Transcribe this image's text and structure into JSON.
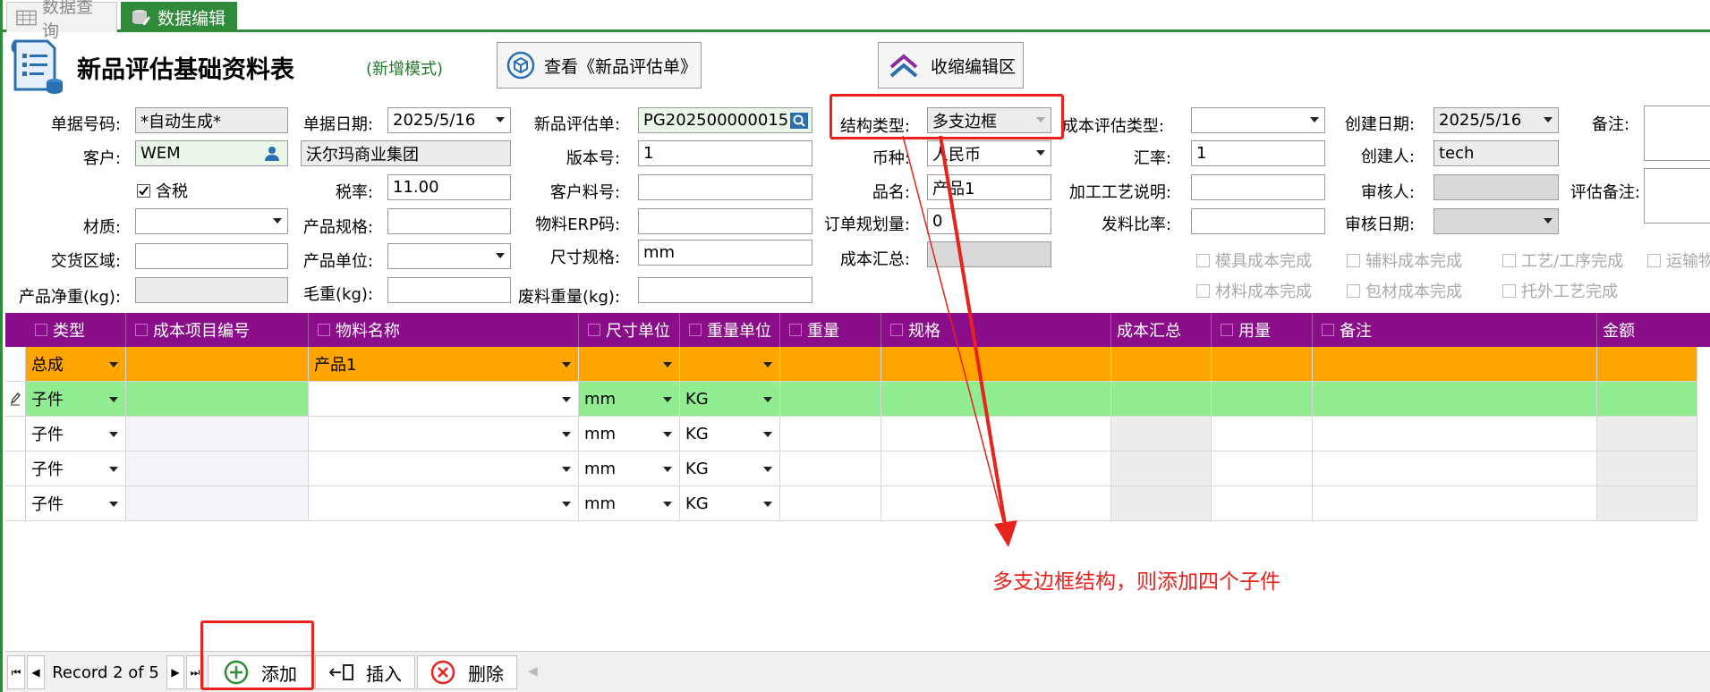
{
  "tabs": [
    {
      "label": "数据查询",
      "icon": "grid-table-icon",
      "active": false
    },
    {
      "label": "数据编辑",
      "icon": "database-edit-icon",
      "active": true
    }
  ],
  "header": {
    "title": "新品评估基础资料表",
    "mode": "(新增模式)",
    "view_button": "查看《新品评估单》",
    "collapse_button": "收缩编辑区"
  },
  "form": {
    "doc_no": {
      "label": "单据号码:",
      "value": "*自动生成*"
    },
    "doc_date": {
      "label": "单据日期:",
      "value": "2025/5/16"
    },
    "eval_no": {
      "label": "新品评估单:",
      "value": "PG202500000015"
    },
    "struct_type": {
      "label": "结构类型:",
      "value": "多支边框"
    },
    "cost_eval_type": {
      "label": "成本评估类型:",
      "value": ""
    },
    "create_date": {
      "label": "创建日期:",
      "value": "2025/5/16"
    },
    "remark": {
      "label": "备注:",
      "value": ""
    },
    "customer": {
      "label": "客户:",
      "value": "WEM",
      "name": "沃尔玛商业集团"
    },
    "version": {
      "label": "版本号:",
      "value": "1"
    },
    "currency": {
      "label": "币种:",
      "value": "人民币"
    },
    "rate": {
      "label": "汇率:",
      "value": "1"
    },
    "creator": {
      "label": "创建人:",
      "value": "tech"
    },
    "tax": {
      "label": "含税",
      "checked": true
    },
    "tax_rate": {
      "label": "税率:",
      "value": "11.00"
    },
    "cust_part": {
      "label": "客户料号:",
      "value": ""
    },
    "product_name": {
      "label": "品名:",
      "value": "产品1"
    },
    "process_desc": {
      "label": "加工工艺说明:",
      "value": ""
    },
    "auditor": {
      "label": "审核人:",
      "value": ""
    },
    "eval_remark": {
      "label": "评估备注:",
      "value": ""
    },
    "material": {
      "label": "材质:",
      "value": ""
    },
    "spec": {
      "label": "产品规格:",
      "value": ""
    },
    "erp_code": {
      "label": "物料ERP码:",
      "value": ""
    },
    "order_plan": {
      "label": "订单规划量:",
      "value": "0"
    },
    "issue_ratio": {
      "label": "发料比率:",
      "value": ""
    },
    "audit_date": {
      "label": "审核日期:",
      "value": ""
    },
    "delivery": {
      "label": "交货区域:",
      "value": ""
    },
    "unit": {
      "label": "产品单位:",
      "value": ""
    },
    "size_spec": {
      "label": "尺寸规格:",
      "value": "mm"
    },
    "cost_total": {
      "label": "成本汇总:",
      "value": ""
    },
    "net_weight": {
      "label": "产品净重(kg):",
      "value": ""
    },
    "gross_weight": {
      "label": "毛重(kg):",
      "value": ""
    },
    "scrap_weight": {
      "label": "废料重量(kg):",
      "value": ""
    }
  },
  "checks": [
    "模具成本完成",
    "辅料成本完成",
    "工艺/工序完成",
    "运输物",
    "材料成本完成",
    "包材成本完成",
    "托外工艺完成"
  ],
  "grid": {
    "columns": [
      "类型",
      "成本项目编号",
      "物料名称",
      "尺寸单位",
      "重量单位",
      "重量",
      "规格",
      "成本汇总",
      "用量",
      "备注",
      "金额"
    ],
    "rows": [
      {
        "type": "总成",
        "item": "",
        "material": "产品1",
        "size_unit": "",
        "weight_unit": "",
        "style": "orange"
      },
      {
        "type": "子件",
        "item": "",
        "material": "",
        "size_unit": "mm",
        "weight_unit": "KG",
        "style": "green"
      },
      {
        "type": "子件",
        "item": "",
        "material": "",
        "size_unit": "mm",
        "weight_unit": "KG",
        "style": "light"
      },
      {
        "type": "子件",
        "item": "",
        "material": "",
        "size_unit": "mm",
        "weight_unit": "KG",
        "style": "light"
      },
      {
        "type": "子件",
        "item": "",
        "material": "",
        "size_unit": "mm",
        "weight_unit": "KG",
        "style": "light"
      }
    ]
  },
  "nav": {
    "record": "Record 2 of 5",
    "add": "添加",
    "insert": "插入",
    "delete": "删除"
  },
  "annotation": "多支边框结构，则添加四个子件",
  "colors": {
    "accent_green": "#2f8a3a",
    "header_purple": "#8a0d8a",
    "orange": "#ffa500",
    "green_row": "#90ee90",
    "annotation_red": "#e8221c"
  }
}
